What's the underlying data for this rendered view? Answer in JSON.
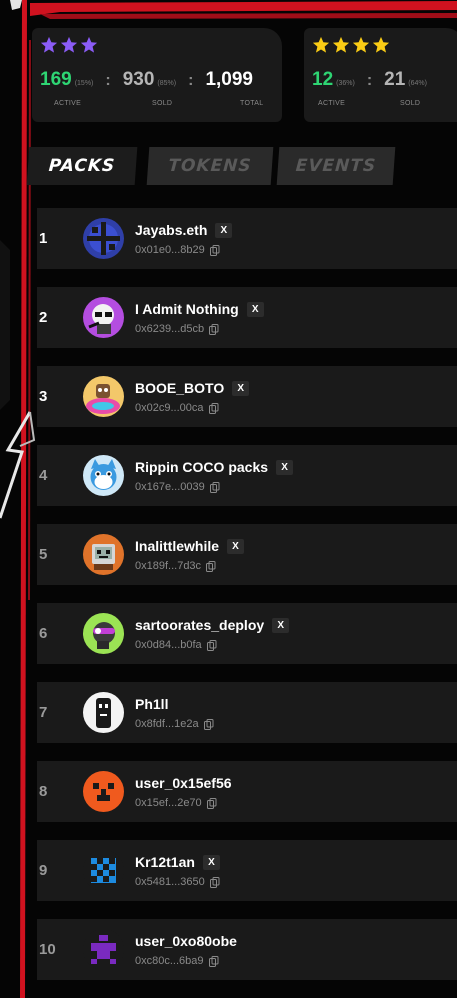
{
  "stats": {
    "card1": {
      "stars": 3,
      "star_color": "#8b5cf6",
      "active": "169",
      "active_pct": "(15%)",
      "sold": "930",
      "sold_pct": "(85%)",
      "total": "1,099",
      "label_active": "ACTIVE",
      "label_sold": "SOLD",
      "label_total": "TOTAL"
    },
    "card2": {
      "stars": 4,
      "star_color": "#facc15",
      "active": "12",
      "active_pct": "(36%)",
      "sold": "21",
      "sold_pct": "(64%)",
      "label_active": "ACTIVE",
      "label_sold": "SOLD"
    }
  },
  "tabs": [
    {
      "label": "PACKS",
      "active": true
    },
    {
      "label": "TOKENS",
      "active": false
    },
    {
      "label": "EVENTS",
      "active": false
    }
  ],
  "leaderboard": [
    {
      "rank": "1",
      "name": "Jayabs.eth",
      "x": true,
      "address": "0x01e0...8b29",
      "avatar": "blue-pixel-icon"
    },
    {
      "rank": "2",
      "name": "I Admit Nothing",
      "x": true,
      "address": "0x6239...d5cb",
      "avatar": "purple-zombie-icon"
    },
    {
      "rank": "3",
      "name": "BOOE_BOTO",
      "x": true,
      "address": "0x02c9...00ca",
      "avatar": "cartoon-pool-icon"
    },
    {
      "rank": "4",
      "name": "Rippin COCO packs",
      "x": true,
      "address": "0x167e...0039",
      "avatar": "blue-cat-icon"
    },
    {
      "rank": "5",
      "name": "Inalittlewhile",
      "x": true,
      "address": "0x189f...7d3c",
      "avatar": "tv-robot-icon"
    },
    {
      "rank": "6",
      "name": "sartoorates_deploy",
      "x": true,
      "address": "0x0d84...b0fa",
      "avatar": "green-helmet-icon"
    },
    {
      "rank": "7",
      "name": "Ph1ll",
      "x": false,
      "address": "0x8fdf...1e2a",
      "avatar": "bw-figure-icon"
    },
    {
      "rank": "8",
      "name": "user_0x15ef56",
      "x": false,
      "address": "0x15ef...2e70",
      "avatar": "orange-pixel-icon"
    },
    {
      "rank": "9",
      "name": "Kr12t1an",
      "x": true,
      "address": "0x5481...3650",
      "avatar": "blue-checker-icon"
    },
    {
      "rank": "10",
      "name": "user_0xo80obe",
      "x": false,
      "address": "0xc80c...6ba9",
      "avatar": "purple-pixel-icon"
    }
  ],
  "x_badge_label": "X",
  "colors": {
    "accent_red": "#e11d2a",
    "active_green": "#2ed573",
    "row_bg": "#1a1a1a"
  }
}
